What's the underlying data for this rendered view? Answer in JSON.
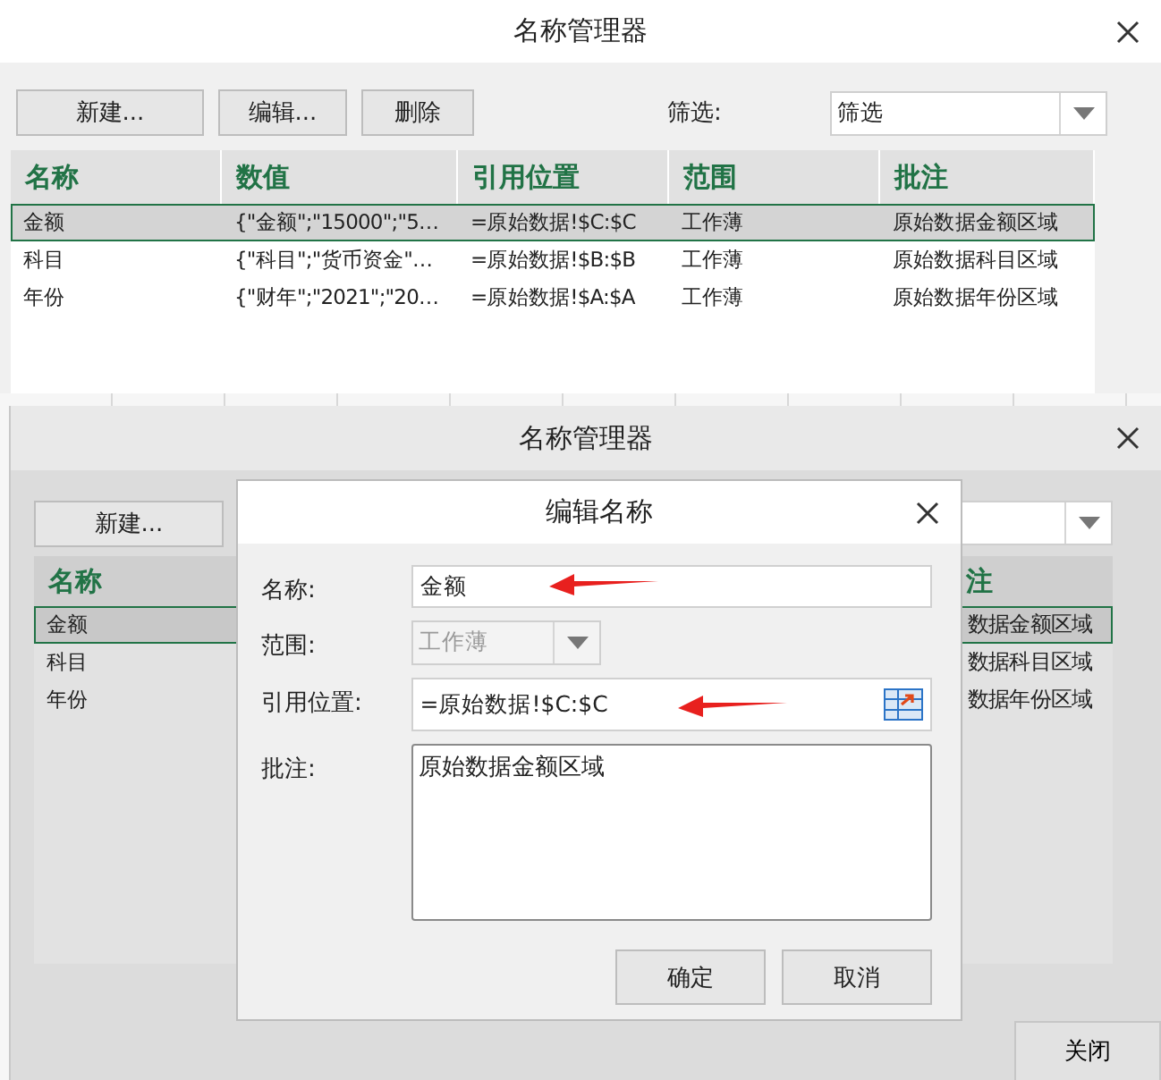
{
  "name_manager": {
    "title": "名称管理器",
    "buttons": [
      "新建...",
      "编辑...",
      "删除"
    ],
    "filter_label": "筛选:",
    "filter_value": "筛选",
    "columns": [
      "名称",
      "数值",
      "引用位置",
      "范围",
      "批注"
    ],
    "rows": [
      {
        "name": "金额",
        "value": "{\"金额\";\"15000\";\"5…",
        "refers_to": "=原始数据!$C:$C",
        "scope": "工作薄",
        "comment": "原始数据金额区域",
        "selected": true
      },
      {
        "name": "科目",
        "value": "{\"科目\";\"货币资金\"…",
        "refers_to": "=原始数据!$B:$B",
        "scope": "工作薄",
        "comment": "原始数据科目区域",
        "selected": false
      },
      {
        "name": "年份",
        "value": "{\"财年\";\"2021\";\"20…",
        "refers_to": "=原始数据!$A:$A",
        "scope": "工作薄",
        "comment": "原始数据年份区域",
        "selected": false
      }
    ]
  },
  "background_dialog": {
    "title": "名称管理器",
    "buttons": [
      "新建..."
    ],
    "columns": [
      "名称",
      "注"
    ],
    "rows": [
      {
        "name": "金额",
        "comment": "数据金额区域",
        "selected": true
      },
      {
        "name": "科目",
        "comment": "数据科目区域",
        "selected": false
      },
      {
        "name": "年份",
        "comment": "数据年份区域",
        "selected": false
      }
    ],
    "close_button": "关闭"
  },
  "edit_dialog": {
    "title": "编辑名称",
    "fields": [
      {
        "kind": "text",
        "label": "名称:",
        "value": "金额",
        "disabled": false,
        "arrow": true
      },
      {
        "kind": "select",
        "label": "范围:",
        "value": "工作薄",
        "disabled": true,
        "arrow": false
      },
      {
        "kind": "reference",
        "label": "引用位置:",
        "value": "=原始数据!$C:$C",
        "disabled": false,
        "arrow": true
      },
      {
        "kind": "textarea",
        "label": "批注:",
        "value": "原始数据金额区域",
        "disabled": false,
        "arrow": false
      }
    ],
    "buttons": [
      "确定",
      "取消"
    ]
  }
}
